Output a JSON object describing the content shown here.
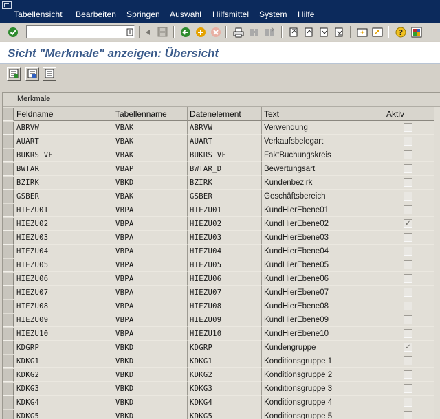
{
  "menu": {
    "items": [
      "Tabellensicht",
      "Bearbeiten",
      "Springen",
      "Auswahl",
      "Hilfsmittel",
      "System",
      "Hilfe"
    ]
  },
  "toolbar": {
    "command_field_value": "",
    "icons": [
      "enter-icon",
      "history-dropdown-icon",
      "back-arrow-icon",
      "save-icon",
      "back-icon",
      "exit-icon",
      "cancel-icon",
      "print-icon",
      "find-icon",
      "find-next-icon",
      "first-page-icon",
      "previous-page-icon",
      "next-page-icon",
      "last-page-icon",
      "create-session-icon",
      "shortcut-icon",
      "help-icon",
      "layout-menu-icon"
    ]
  },
  "title": "Sicht \"Merkmale\" anzeigen: Übersicht",
  "app_toolbar": {
    "icons": [
      "details-icon",
      "select-all-icon",
      "deselect-all-icon"
    ]
  },
  "table": {
    "caption": "Merkmale",
    "columns": [
      "Feldname",
      "Tabellenname",
      "Datenelement",
      "Text",
      "Aktiv"
    ],
    "rows": [
      {
        "feldname": "ABRVW",
        "tabelle": "VBAK",
        "datenelement": "ABRVW",
        "text": "Verwendung",
        "aktiv": false
      },
      {
        "feldname": "AUART",
        "tabelle": "VBAK",
        "datenelement": "AUART",
        "text": "Verkaufsbelegart",
        "aktiv": false
      },
      {
        "feldname": "BUKRS_VF",
        "tabelle": "VBAK",
        "datenelement": "BUKRS_VF",
        "text": "FaktBuchungskreis",
        "aktiv": false
      },
      {
        "feldname": "BWTAR",
        "tabelle": "VBAP",
        "datenelement": "BWTAR_D",
        "text": "Bewertungsart",
        "aktiv": false
      },
      {
        "feldname": "BZIRK",
        "tabelle": "VBKD",
        "datenelement": "BZIRK",
        "text": "Kundenbezirk",
        "aktiv": false
      },
      {
        "feldname": "GSBER",
        "tabelle": "VBAK",
        "datenelement": "GSBER",
        "text": "Geschäftsbereich",
        "aktiv": false
      },
      {
        "feldname": "HIEZU01",
        "tabelle": "VBPA",
        "datenelement": "HIEZU01",
        "text": "KundHierEbene01",
        "aktiv": false
      },
      {
        "feldname": "HIEZU02",
        "tabelle": "VBPA",
        "datenelement": "HIEZU02",
        "text": "KundHierEbene02",
        "aktiv": true
      },
      {
        "feldname": "HIEZU03",
        "tabelle": "VBPA",
        "datenelement": "HIEZU03",
        "text": "KundHierEbene03",
        "aktiv": false
      },
      {
        "feldname": "HIEZU04",
        "tabelle": "VBPA",
        "datenelement": "HIEZU04",
        "text": "KundHierEbene04",
        "aktiv": false
      },
      {
        "feldname": "HIEZU05",
        "tabelle": "VBPA",
        "datenelement": "HIEZU05",
        "text": "KundHierEbene05",
        "aktiv": false
      },
      {
        "feldname": "HIEZU06",
        "tabelle": "VBPA",
        "datenelement": "HIEZU06",
        "text": "KundHierEbene06",
        "aktiv": false
      },
      {
        "feldname": "HIEZU07",
        "tabelle": "VBPA",
        "datenelement": "HIEZU07",
        "text": "KundHierEbene07",
        "aktiv": false
      },
      {
        "feldname": "HIEZU08",
        "tabelle": "VBPA",
        "datenelement": "HIEZU08",
        "text": "KundHierEbene08",
        "aktiv": false
      },
      {
        "feldname": "HIEZU09",
        "tabelle": "VBPA",
        "datenelement": "HIEZU09",
        "text": "KundHierEbene09",
        "aktiv": false
      },
      {
        "feldname": "HIEZU10",
        "tabelle": "VBPA",
        "datenelement": "HIEZU10",
        "text": "KundHierEbene10",
        "aktiv": false
      },
      {
        "feldname": "KDGRP",
        "tabelle": "VBKD",
        "datenelement": "KDGRP",
        "text": "Kundengruppe",
        "aktiv": true
      },
      {
        "feldname": "KDKG1",
        "tabelle": "VBKD",
        "datenelement": "KDKG1",
        "text": "Konditionsgruppe 1",
        "aktiv": false
      },
      {
        "feldname": "KDKG2",
        "tabelle": "VBKD",
        "datenelement": "KDKG2",
        "text": "Konditionsgruppe 2",
        "aktiv": false
      },
      {
        "feldname": "KDKG3",
        "tabelle": "VBKD",
        "datenelement": "KDKG3",
        "text": "Konditionsgruppe 3",
        "aktiv": false
      },
      {
        "feldname": "KDKG4",
        "tabelle": "VBKD",
        "datenelement": "KDKG4",
        "text": "Konditionsgruppe 4",
        "aktiv": false
      },
      {
        "feldname": "KDKG5",
        "tabelle": "VBKD",
        "datenelement": "KDKG5",
        "text": "Konditionsgruppe 5",
        "aktiv": false
      }
    ]
  },
  "colors": {
    "menubar": "#0c2a5c",
    "title_text": "#3a5a8a",
    "enter_green": "#2e8b2e"
  }
}
